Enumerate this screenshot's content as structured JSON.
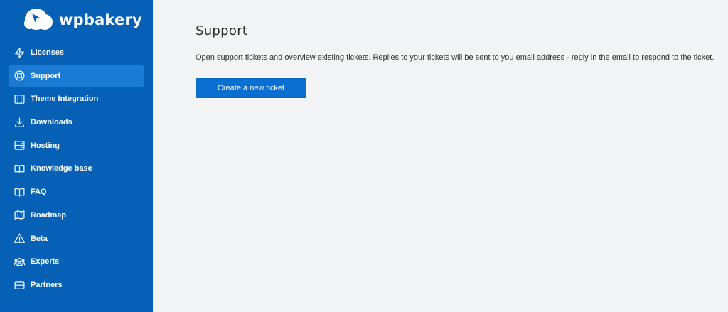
{
  "brand": {
    "name": "wpbakery",
    "color": "#0661b6",
    "active_color": "#1a7ad4",
    "accent_button": "#0a6fd1"
  },
  "sidebar": {
    "items": [
      {
        "label": "Licenses",
        "icon": "bolt-icon",
        "active": false
      },
      {
        "label": "Support",
        "icon": "lifebuoy-icon",
        "active": true
      },
      {
        "label": "Theme Integration",
        "icon": "columns-icon",
        "active": false
      },
      {
        "label": "Downloads",
        "icon": "download-icon",
        "active": false
      },
      {
        "label": "Hosting",
        "icon": "server-icon",
        "active": false
      },
      {
        "label": "Knowledge base",
        "icon": "book-open-icon",
        "active": false
      },
      {
        "label": "FAQ",
        "icon": "book-icon",
        "active": false
      },
      {
        "label": "Roadmap",
        "icon": "map-icon",
        "active": false
      },
      {
        "label": "Beta",
        "icon": "warning-triangle-icon",
        "active": false
      },
      {
        "label": "Experts",
        "icon": "users-icon",
        "active": false
      },
      {
        "label": "Partners",
        "icon": "briefcase-icon",
        "active": false
      }
    ]
  },
  "main": {
    "title": "Support",
    "description": "Open support tickets and overview existing tickets. Replies to your tickets will be sent to you email address - reply in the email to respond to the ticket.",
    "create_button_label": "Create a new ticket"
  }
}
